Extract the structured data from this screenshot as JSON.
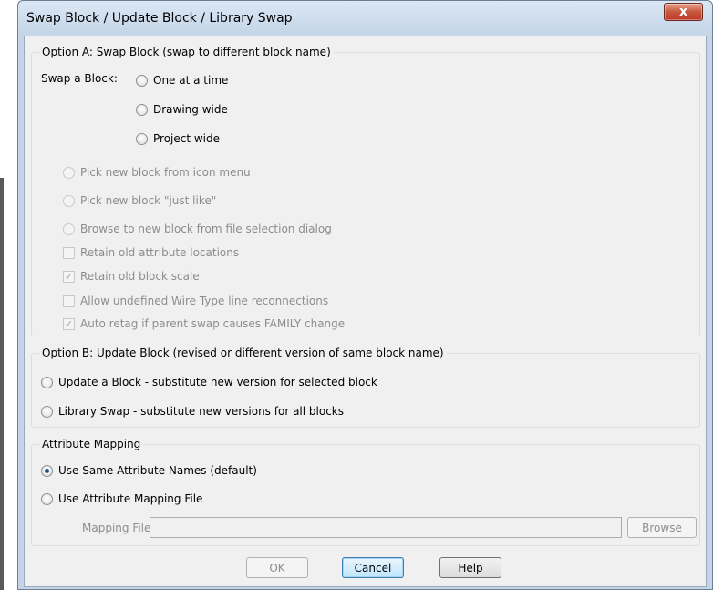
{
  "window": {
    "title": "Swap Block / Update Block / Library Swap",
    "close_symbol": "x"
  },
  "option_a": {
    "legend": "Option A: Swap Block (swap to different block name)",
    "swap_label": "Swap a Block:",
    "swap_options": [
      "One at a time",
      "Drawing wide",
      "Project wide"
    ],
    "pick_options": [
      "Pick new block from icon menu",
      "Pick new block \"just like\"",
      "Browse to new block from file selection dialog"
    ],
    "checks": [
      {
        "label": "Retain old attribute locations",
        "checked": false
      },
      {
        "label": "Retain old block scale",
        "checked": true
      },
      {
        "label": "Allow undefined Wire Type line reconnections",
        "checked": false
      },
      {
        "label": "Auto retag if parent swap causes FAMILY change",
        "checked": true
      }
    ]
  },
  "option_b": {
    "legend": "Option B: Update Block (revised or different version of same block name)",
    "options": [
      "Update a Block - substitute new version for selected block",
      "Library Swap - substitute new versions for all blocks"
    ]
  },
  "attribute_mapping": {
    "legend": "Attribute Mapping",
    "options": [
      "Use Same Attribute Names (default)",
      "Use Attribute Mapping File"
    ],
    "mapping_label": "Mapping File",
    "mapping_value": "",
    "browse_label": "Browse"
  },
  "buttons": {
    "ok": "OK",
    "cancel": "Cancel",
    "help": "Help"
  },
  "icons": {
    "close": "close-icon",
    "check": "✓"
  }
}
